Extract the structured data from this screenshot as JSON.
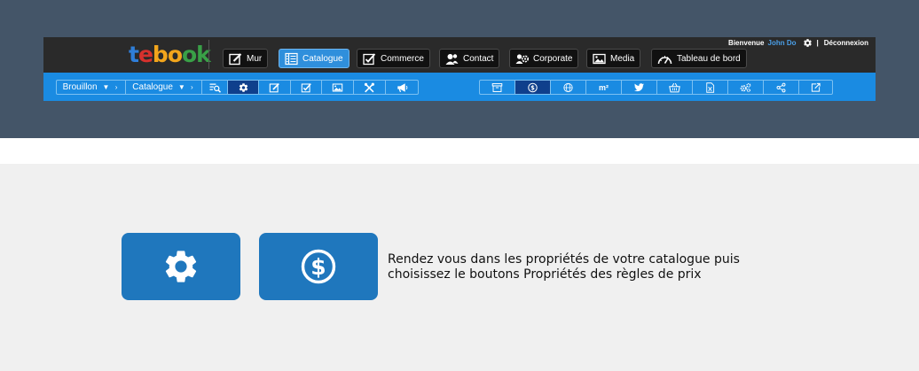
{
  "header": {
    "logo": {
      "p1": "t",
      "p2": "e",
      "p3": "bo",
      "p4": "ok"
    },
    "user": {
      "welcome": "Bienvenue",
      "name": "John Do",
      "logout": "Déconnexion"
    },
    "nav": [
      {
        "label": "Mur",
        "icon": "edit-icon"
      },
      {
        "label": "Catalogue",
        "icon": "catalog-icon",
        "active": true
      },
      {
        "label": "Commerce",
        "icon": "checklist-icon"
      },
      {
        "label": "Contact",
        "icon": "contacts-icon"
      },
      {
        "label": "Corporate",
        "icon": "corporate-icon"
      },
      {
        "label": "Media",
        "icon": "image-icon"
      },
      {
        "label": "Tableau de bord",
        "icon": "dashboard-gauge-icon"
      }
    ]
  },
  "toolbar": {
    "status_select": "Brouillon",
    "catalog_select": "Catalogue",
    "left_tools": [
      "search-list-icon",
      "gear-icon",
      "edit-icon",
      "checklist-icon",
      "image-icon",
      "tools-icon",
      "megaphone-icon"
    ],
    "m2_label": "m²",
    "right_tools": [
      "archive-icon",
      "dollar-icon",
      "globe-icon",
      "square-meter-icon",
      "twitter-icon",
      "basket-icon",
      "excel-icon",
      "cogs-icon",
      "share-icon",
      "external-link-icon"
    ]
  },
  "content": {
    "settings_button_icon": "gear-icon",
    "price_rules_button_icon": "dollar-circle-icon",
    "instruction": "Rendez vous dans les propriétés de votre catalogue puis choisissez le boutons Propriétés des règles de prix"
  },
  "colors": {
    "header_band": "#445568",
    "main_bar": "#2a2a2a",
    "toolbar": "#1a8be2",
    "active_tab": "#2f8fdc",
    "dark_cell": "#0f3f8c",
    "big_button": "#1f77bd",
    "content_bg": "#f0f0f0",
    "username": "#4a9fe8"
  }
}
